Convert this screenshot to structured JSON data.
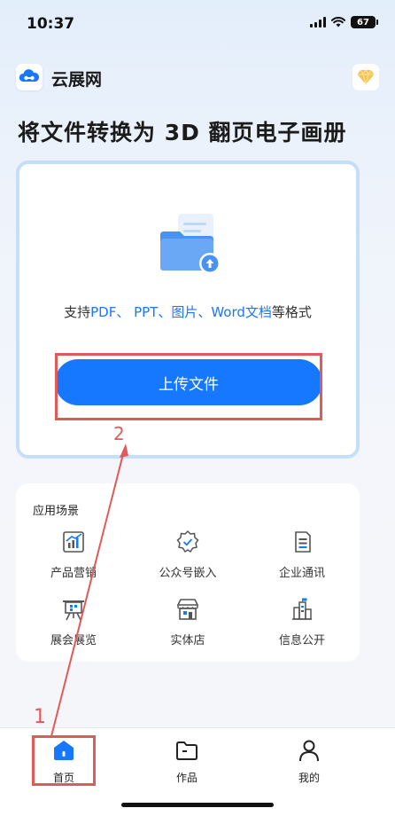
{
  "status_bar": {
    "time": "10:37",
    "battery": "67"
  },
  "header": {
    "app_name": "云展网"
  },
  "title": "将文件转换为 3D 翻页电子画册",
  "upload": {
    "formats_prefix": "支持",
    "formats_hl1": "PDF、 PPT、图片、Word文档",
    "formats_suffix": "等格式",
    "button_label": "上传文件"
  },
  "scenes": {
    "title": "应用场景",
    "items": [
      {
        "label": "产品营销",
        "icon": "chart-icon"
      },
      {
        "label": "公众号嵌入",
        "icon": "badge-check-icon"
      },
      {
        "label": "企业通讯",
        "icon": "document-icon"
      },
      {
        "label": "展会展览",
        "icon": "easel-icon"
      },
      {
        "label": "实体店",
        "icon": "store-icon"
      },
      {
        "label": "信息公开",
        "icon": "building-icon"
      }
    ]
  },
  "tabs": [
    {
      "label": "首页",
      "icon": "home-icon"
    },
    {
      "label": "作品",
      "icon": "folder-icon"
    },
    {
      "label": "我的",
      "icon": "user-icon"
    }
  ],
  "annotations": {
    "step1": "1",
    "step2": "2"
  },
  "colors": {
    "accent": "#1677ff",
    "annotation": "#e05a5a"
  }
}
